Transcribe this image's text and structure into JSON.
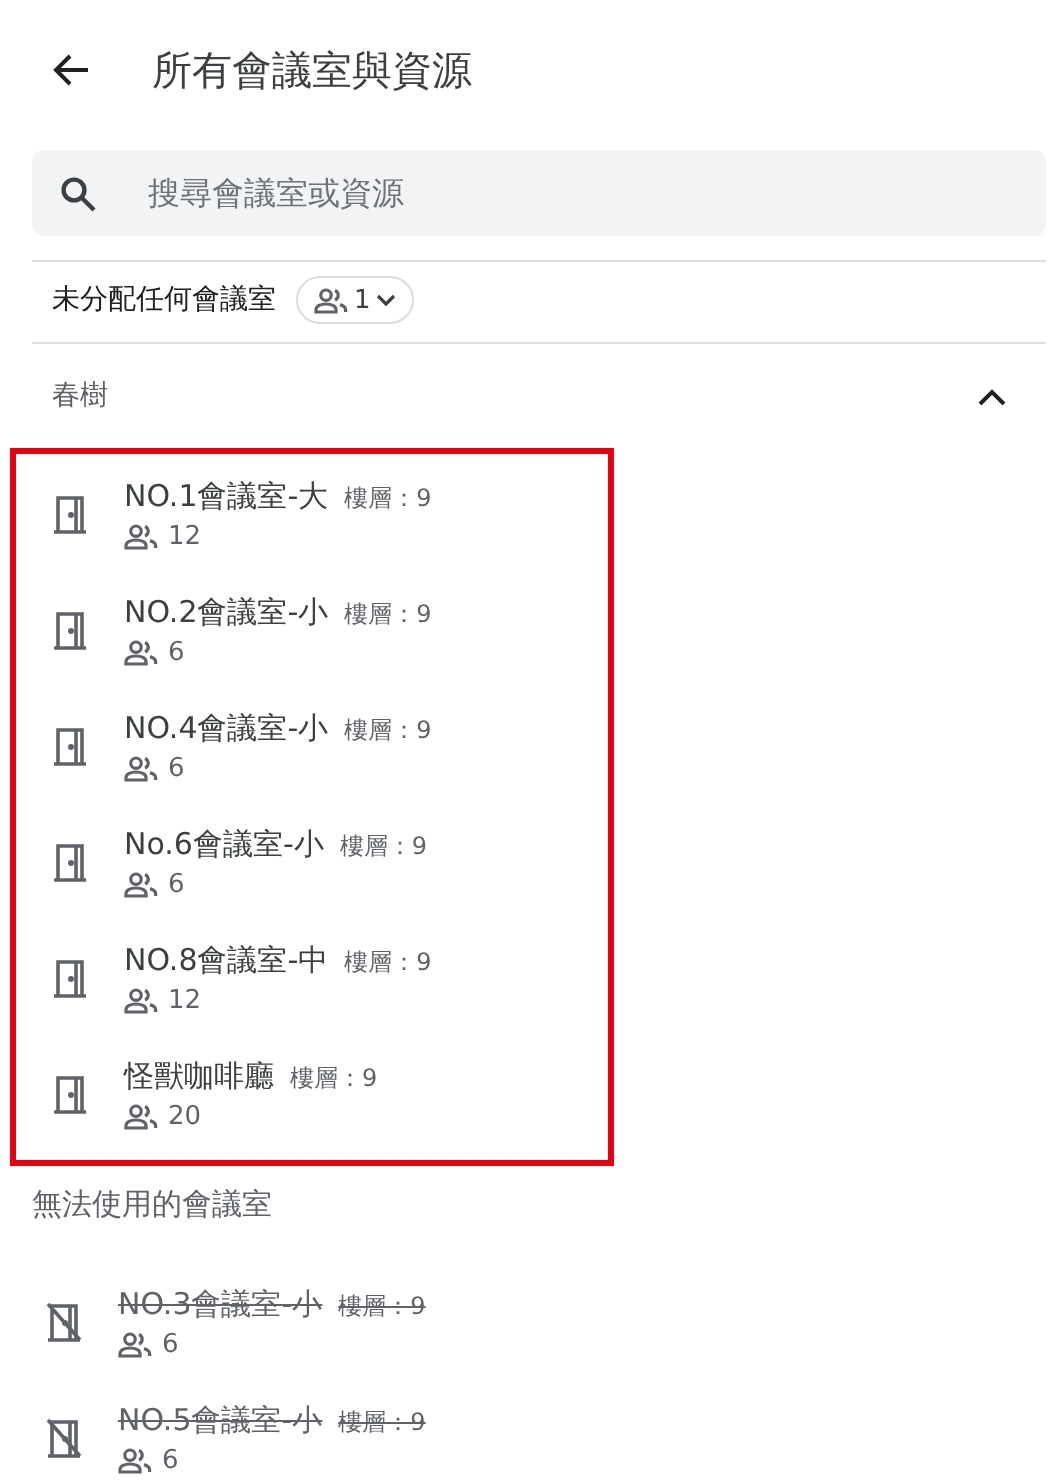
{
  "header": {
    "title": "所有會議室與資源"
  },
  "search": {
    "placeholder": "搜尋會議室或資源"
  },
  "unassigned": {
    "label": "未分配任何會議室",
    "count": "1"
  },
  "groups": [
    {
      "title": "春樹",
      "expanded": true,
      "highlighted": true,
      "rooms": [
        {
          "name": "NO.1會議室-大",
          "floor": "樓層：9",
          "capacity": "12",
          "available": true
        },
        {
          "name": "NO.2會議室-小",
          "floor": "樓層：9",
          "capacity": "6",
          "available": true
        },
        {
          "name": "NO.4會議室-小",
          "floor": "樓層：9",
          "capacity": "6",
          "available": true
        },
        {
          "name": "No.6會議室-小",
          "floor": "樓層：9",
          "capacity": "6",
          "available": true
        },
        {
          "name": "NO.8會議室-中",
          "floor": "樓層：9",
          "capacity": "12",
          "available": true
        },
        {
          "name": "怪獸咖啡廳",
          "floor": "樓層：9",
          "capacity": "20",
          "available": true
        }
      ]
    }
  ],
  "unavailable": {
    "title": "無法使用的會議室",
    "rooms": [
      {
        "name": "NO.3會議室-小",
        "floor": "樓層：9",
        "capacity": "6",
        "available": false
      },
      {
        "name": "NO.5會議室-小",
        "floor": "樓層：9",
        "capacity": "6",
        "available": false
      }
    ]
  }
}
